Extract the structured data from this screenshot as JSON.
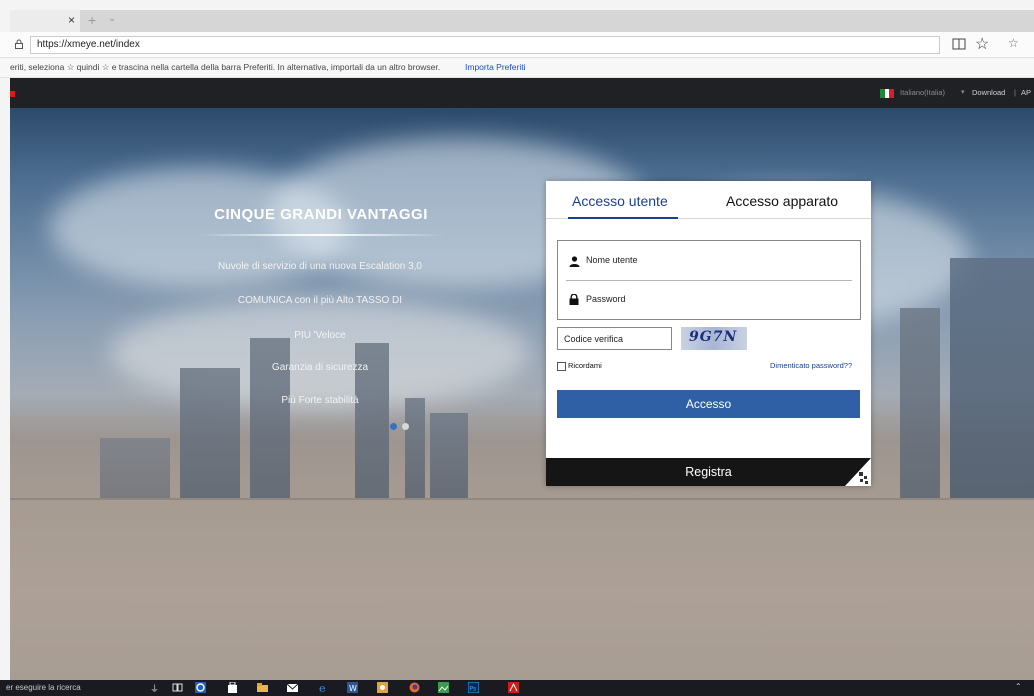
{
  "browser": {
    "tab_close": "×",
    "tab_new": "+",
    "tab_chevron": "⌄",
    "url": "https://xmeye.net/index",
    "favorites_hint": "eriti, seleziona ☆ quindi ☆ e trascina nella cartella della barra Preferiti. In alternativa, importali da un altro browser.",
    "favorites_link": "Importa Preferiti",
    "icons": [
      "lock-icon",
      "reading-view-icon",
      "star-icon",
      "favorites-icon"
    ]
  },
  "site_header": {
    "language": "Italiano(Italia)",
    "language_caret": "▾",
    "download": "Download",
    "separator": "|",
    "app": "AP"
  },
  "hero": {
    "title": "CINQUE GRANDI VANTAGGI",
    "items": [
      "Nuvole di servizio di una nuova Escalation 3,0",
      "COMUNICA con il più Alto TASSO DI",
      "PIU 'Veloce",
      "Garanzia di sicurezza",
      "Più Forte stabilità"
    ]
  },
  "login": {
    "tab_user": "Accesso utente",
    "tab_device": "Accesso apparato",
    "username_placeholder": "Nome utente",
    "password_placeholder": "Password",
    "captcha_placeholder": "Codice verifica",
    "captcha_code": "9G7N",
    "remember": "Ricordami",
    "forgot": "Dimenticato password??",
    "submit": "Accesso",
    "register": "Registra"
  },
  "taskbar": {
    "search": "er eseguire la ricerca",
    "colors": {
      "accent_blue": "#2f5fa5",
      "brand_red": "#d81c1c"
    }
  }
}
